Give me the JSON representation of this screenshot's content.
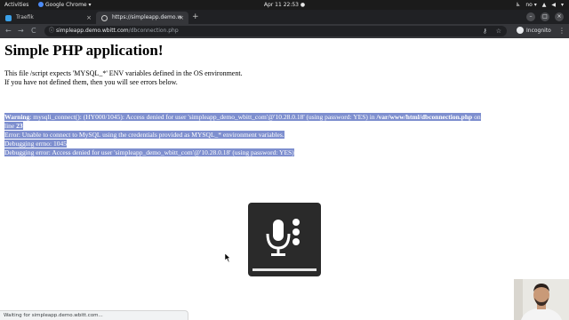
{
  "topbar": {
    "activities": "Activities",
    "app_menu": "Google Chrome ▾",
    "clock": "Apr 11  22:53 ●",
    "tray": {
      "lang": "no ▾",
      "accessibility": "♿",
      "network": "▲",
      "volume": "◀",
      "power": "▾"
    }
  },
  "tabs": [
    {
      "title": "Traefik",
      "close": "×"
    },
    {
      "title": "https://simpleapp.demo.w",
      "close": "×"
    }
  ],
  "newtab_label": "+",
  "window_controls": {
    "minimize": "–",
    "maximize": "□",
    "close": "×"
  },
  "toolbar": {
    "back": "←",
    "forward": "→",
    "reload": "C",
    "info": "ⓘ",
    "url_host": "simpleapp.demo.wbitt.com",
    "url_path": "/dbconnection.php",
    "key": "⚷",
    "star": "☆",
    "incognito": "Incognito",
    "menu": "⋮"
  },
  "page": {
    "title": "Simple PHP application!",
    "intro_line1": "This file /script expects 'MYSQL_*' ENV variables defined in the OS environment.",
    "intro_line2": "If you have not defined them, then you will see errors below.",
    "warning_label": "Warning",
    "warning_text": ": mysqli_connect(): (HY000/1045): Access denied for user 'simpleapp_demo_wbitt_com'@'10.28.0.18' (using password: YES) in ",
    "warning_file": "/var/www/html/dbconnection.php",
    "warning_on": " on",
    "warning_line_prefix": "line ",
    "warning_line": "23",
    "error_line": "Error: Unable to connect to MySQL using the credentials provided as MYSQL_* environment variables.",
    "errno_line": "Debugging errno: 1045",
    "debug_error_line": "Debugging error: Access denied for user 'simpleapp_demo_wbitt_com'@'10.28.0.18' (using password: YES)"
  },
  "status_bar": "Waiting for simpleapp.demo.wbitt.com...",
  "colors": {
    "selection": "#7e8fcf",
    "chrome_dark": "#202124",
    "toolbar": "#35363a"
  }
}
